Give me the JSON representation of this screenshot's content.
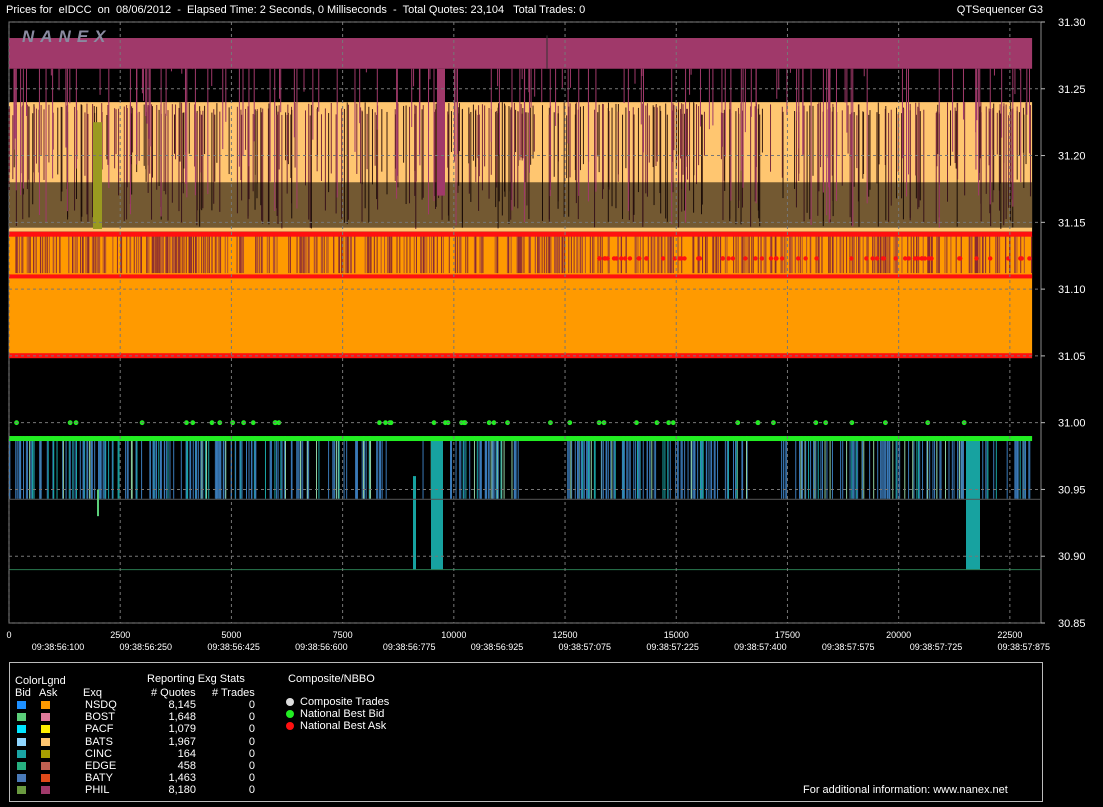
{
  "header": {
    "title": "Prices for  eIDCC  on  08/06/2012  -  Elapsed Time: 2 Seconds, 0 Milliseconds  -  Total Quotes: 23,104   Total Trades: 0",
    "app": "QTSequencer G3",
    "logo": "NANEX"
  },
  "chart_data": {
    "type": "line",
    "ylim": [
      30.85,
      31.3
    ],
    "y_ticks": [
      "31.30",
      "31.25",
      "31.20",
      "31.15",
      "31.10",
      "31.05",
      "31.00",
      "30.95",
      "30.90",
      "30.85"
    ],
    "xlim": [
      0,
      23200
    ],
    "x_ticks": [
      "0",
      "2500",
      "5000",
      "7500",
      "10000",
      "12500",
      "15000",
      "17500",
      "20000",
      "22500"
    ],
    "x_time_ticks": [
      "09:38:56:100",
      "09:38:56:250",
      "09:38:56:425",
      "09:38:56:600",
      "09:38:56:775",
      "09:38:56:925",
      "09:38:57:075",
      "09:38:57:225",
      "09:38:57:400",
      "09:38:57:575",
      "09:38:57:725",
      "09:38:57:875"
    ],
    "grid": true,
    "series": [
      {
        "name": "National Best Ask",
        "color": "#ff1010",
        "values_summary": [
          31.14,
          31.11
        ]
      },
      {
        "name": "National Best Bid",
        "color": "#22ee22",
        "values_summary": [
          30.99,
          31.0
        ]
      }
    ],
    "colors": {
      "phil_ask": "#a0396a",
      "nsdq_ask": "#ff9a00",
      "bats_ask": "#ffc670",
      "nbb": "#22ee22",
      "nba": "#ff1010",
      "bid_bars": "#3a7ab8",
      "edge_bid": "#17a2a0"
    }
  },
  "footer_link": "For additional information: www.nanex.net",
  "legend": {
    "colorlgnd_title": "ColorLgnd",
    "bid_hdr": "Bid",
    "ask_hdr": "Ask",
    "stats_title": "Reporting Exg Stats",
    "exq_hdr": "Exq",
    "quotes_hdr": "# Quotes",
    "trades_hdr": "# Trades",
    "composite_title": "Composite/NBBO",
    "rows": [
      {
        "exch": "NSDQ",
        "quotes": "8,145",
        "trades": "0",
        "bid": "#1e90ff",
        "ask": "#ff9a00"
      },
      {
        "exch": "BOST",
        "quotes": "1,648",
        "trades": "0",
        "bid": "#5ccf7a",
        "ask": "#e07a9a"
      },
      {
        "exch": "PACF",
        "quotes": "1,079",
        "trades": "0",
        "bid": "#00e5ff",
        "ask": "#ffee00"
      },
      {
        "exch": "BATS",
        "quotes": "1,967",
        "trades": "0",
        "bid": "#8fd6ff",
        "ask": "#ffc670"
      },
      {
        "exch": "CINC",
        "quotes": "164",
        "trades": "0",
        "bid": "#1aa5a5",
        "ask": "#a8a000"
      },
      {
        "exch": "EDGE",
        "quotes": "458",
        "trades": "0",
        "bid": "#27b080",
        "ask": "#c06050"
      },
      {
        "exch": "BATY",
        "quotes": "1,463",
        "trades": "0",
        "bid": "#4a7ab8",
        "ask": "#e04a1a"
      },
      {
        "exch": "PHIL",
        "quotes": "8,180",
        "trades": "0",
        "bid": "#6a9a40",
        "ask": "#a0396a"
      }
    ],
    "composite": [
      {
        "label": "Composite Trades",
        "color": "#dddddd"
      },
      {
        "label": "National Best Bid",
        "color": "#22ee22"
      },
      {
        "label": "National Best Ask",
        "color": "#ff1010"
      }
    ]
  }
}
